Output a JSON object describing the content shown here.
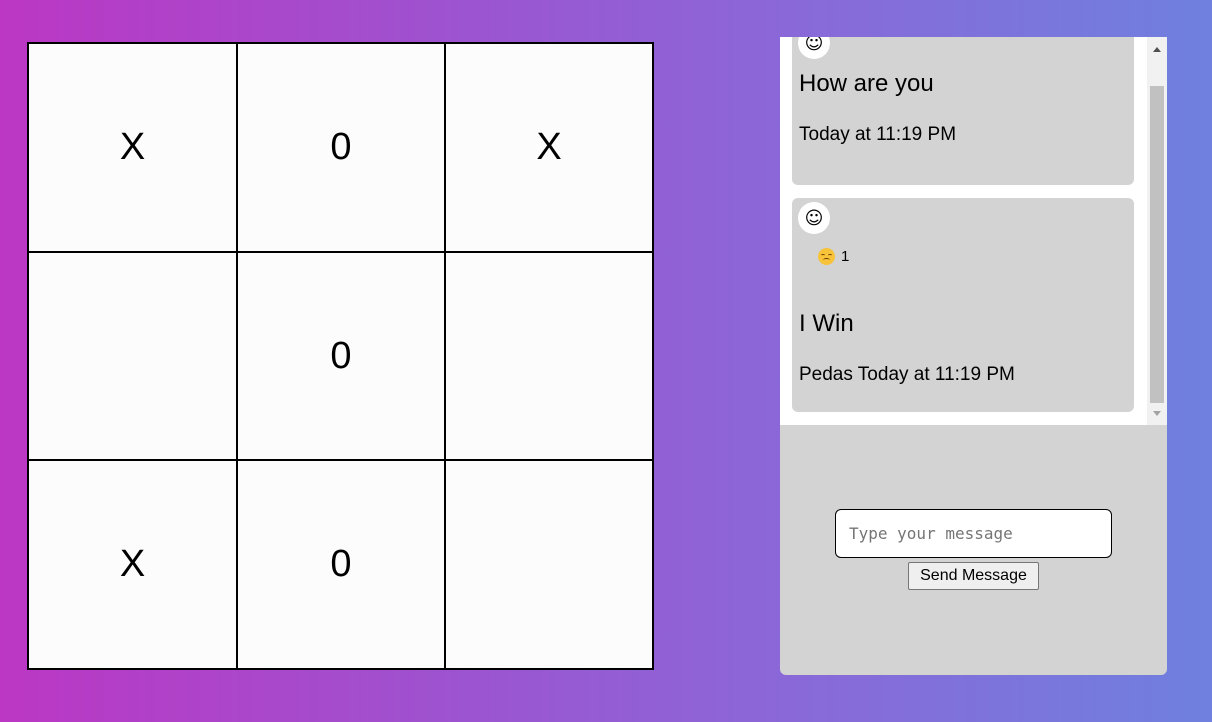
{
  "board": {
    "cells": [
      "X",
      "0",
      "X",
      "",
      "0",
      "",
      "X",
      "0",
      ""
    ]
  },
  "chat": {
    "messages": [
      {
        "avatar_icon": "smiley-face-icon",
        "avatar_glyph": "☺",
        "text": "How are you",
        "meta": "Today at 11:19 PM"
      },
      {
        "avatar_icon": "smiley-face-icon",
        "avatar_glyph": "☺",
        "reaction": {
          "icon": "pensive-face-emoji-icon",
          "count": "1"
        },
        "text": "I Win",
        "meta": "Pedas Today at 11:19 PM"
      }
    ],
    "input": {
      "placeholder": "Type your message",
      "value": ""
    },
    "send_label": "Send Message"
  },
  "colors": {
    "gradient_start": "#bb37c4",
    "gradient_end": "#6f80de",
    "panel_bg": "#d3d3d3",
    "board_bg": "#fcfcfc"
  }
}
